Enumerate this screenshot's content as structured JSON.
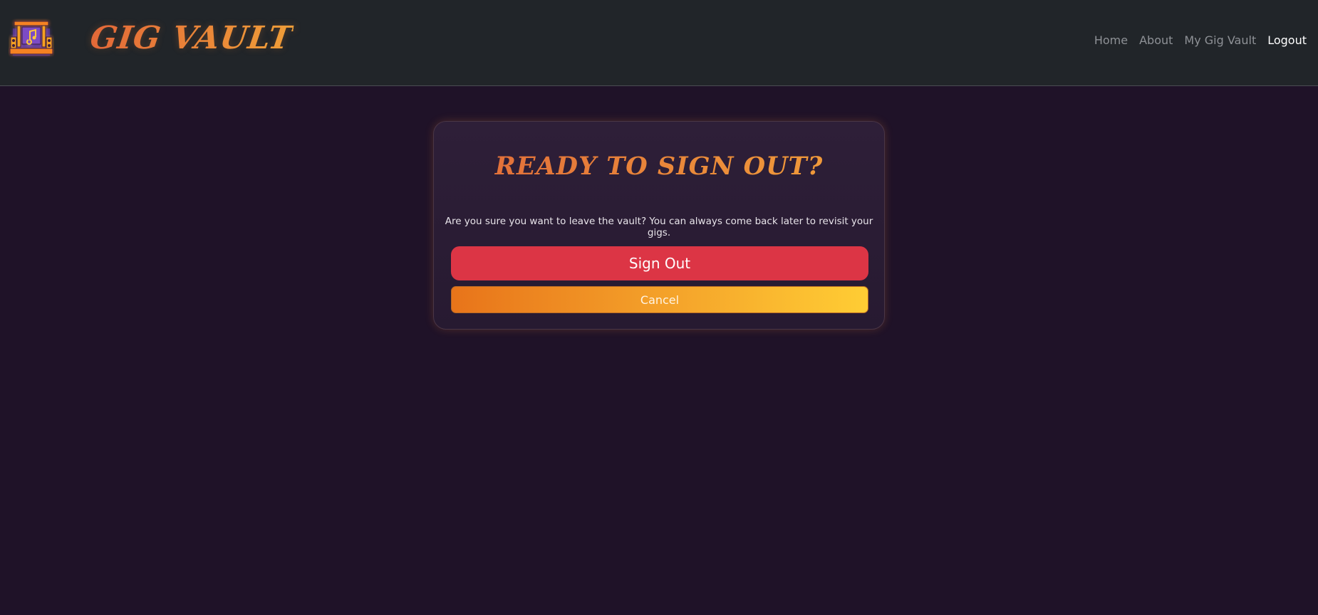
{
  "app": {
    "brand": "GIG VAULT",
    "logo_icon": "stage-music-icon"
  },
  "nav": {
    "items": [
      {
        "label": "Home",
        "active": false
      },
      {
        "label": "About",
        "active": false
      },
      {
        "label": "My Gig Vault",
        "active": false
      },
      {
        "label": "Logout",
        "active": true
      }
    ]
  },
  "dialog": {
    "title": "READY TO SIGN OUT?",
    "message": "Are you sure you want to leave the vault? You can always come back later to revisit your gigs.",
    "sign_out_label": "Sign Out",
    "cancel_label": "Cancel"
  },
  "colors": {
    "page_background": "#1f1228",
    "navbar": "#212529",
    "accent_orange": "#e8741a",
    "accent_yellow": "#ffcd34",
    "danger": "#dc3545"
  }
}
